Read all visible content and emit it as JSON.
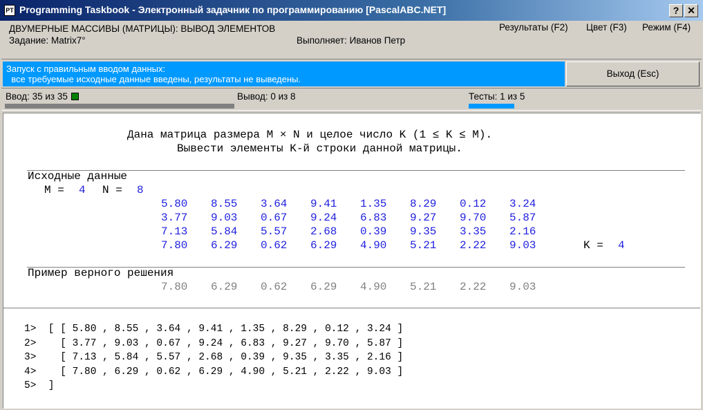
{
  "window": {
    "title": "Programming Taskbook - Электронный задачник по программированию [PascalABC.NET]",
    "icon_label": "PT",
    "help_btn": "?",
    "close_btn": "✕"
  },
  "header": {
    "section": "ДВУМЕРНЫЕ МАССИВЫ (МАТРИЦЫ): ВЫВОД ЭЛЕМЕНТОВ",
    "task": "Задание: Matrix7°",
    "student": "Выполняет: Иванов Петр",
    "menu": {
      "results": "Результаты (F2)",
      "color": "Цвет (F3)",
      "mode": "Режим (F4)"
    }
  },
  "status": {
    "line1": "Запуск с правильным вводом данных:",
    "line2": "  все требуемые исходные данные введены, результаты не выведены.",
    "exit_label": "Выход (Esc)",
    "colors": {
      "message_bg": "#0099ff",
      "input_bar": "#808080",
      "tests_bar": "#0099ff",
      "input_indicator": "#008000"
    }
  },
  "progress": {
    "input": "Ввод: 35 из 35",
    "input_fraction": 1.0,
    "output": "Вывод: 0 из 8",
    "tests": "Тесты: 1 из 5"
  },
  "task": {
    "line1": "Дана матрица размера M × N и целое число K (1 ≤ K ≤ M).",
    "line2": "Вывести элементы K-й строки данной матрицы.",
    "input_title": "Исходные данные",
    "m_label": "M = ",
    "m_value": "4",
    "n_label": "N = ",
    "n_value": "8",
    "matrix": [
      [
        "5.80",
        "8.55",
        "3.64",
        "9.41",
        "1.35",
        "8.29",
        "0.12",
        "3.24"
      ],
      [
        "3.77",
        "9.03",
        "0.67",
        "9.24",
        "6.83",
        "9.27",
        "9.70",
        "5.87"
      ],
      [
        "7.13",
        "5.84",
        "5.57",
        "2.68",
        "0.39",
        "9.35",
        "3.35",
        "2.16"
      ],
      [
        "7.80",
        "6.29",
        "0.62",
        "6.29",
        "4.90",
        "5.21",
        "2.22",
        "9.03"
      ]
    ],
    "k_label": "K = ",
    "k_value": "4",
    "example_title": "Пример верного решения",
    "example": [
      "7.80",
      "6.29",
      "0.62",
      "6.29",
      "4.90",
      "5.21",
      "2.22",
      "9.03"
    ]
  },
  "console": {
    "lines": [
      "1>  [ [ 5.80 , 8.55 , 3.64 , 9.41 , 1.35 , 8.29 , 0.12 , 3.24 ]",
      "2>    [ 3.77 , 9.03 , 0.67 , 9.24 , 6.83 , 9.27 , 9.70 , 5.87 ]",
      "3>    [ 7.13 , 5.84 , 5.57 , 2.68 , 0.39 , 9.35 , 3.35 , 2.16 ]",
      "4>    [ 7.80 , 6.29 , 0.62 , 6.29 , 4.90 , 5.21 , 2.22 , 9.03 ]",
      "5>  ]"
    ]
  }
}
